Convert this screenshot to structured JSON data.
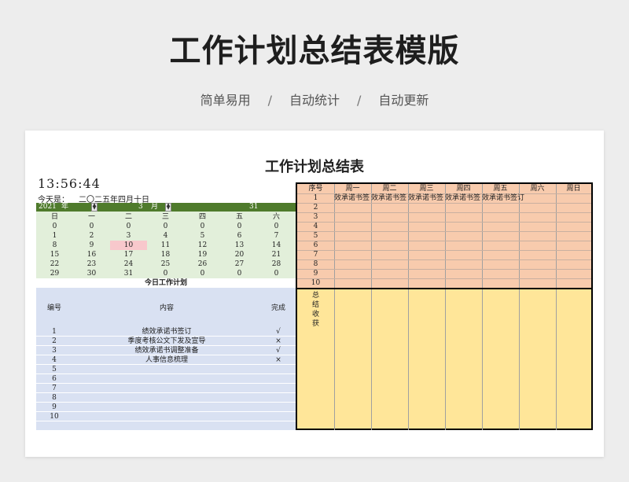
{
  "banner": {
    "title": "工作计划总结表模版",
    "tags": [
      "简单易用",
      "自动统计",
      "自动更新"
    ],
    "separator": "/"
  },
  "sheet": {
    "title": "工作计划总结表",
    "clock": "13:56:44",
    "today_label": "今天是：",
    "today_value": "二〇二五年四月十日",
    "calendar": {
      "year": "2021",
      "year_suffix": "年",
      "month": "3",
      "month_suffix": "月",
      "day": "31",
      "weekdays": [
        "日",
        "一",
        "二",
        "三",
        "四",
        "五",
        "六"
      ],
      "weeks": [
        [
          "0",
          "0",
          "0",
          "0",
          "0",
          "0",
          "0"
        ],
        [
          "1",
          "2",
          "3",
          "4",
          "5",
          "6",
          "7"
        ],
        [
          "8",
          "9",
          "10",
          "11",
          "12",
          "13",
          "14"
        ],
        [
          "15",
          "16",
          "17",
          "18",
          "19",
          "20",
          "21"
        ],
        [
          "22",
          "23",
          "24",
          "25",
          "26",
          "27",
          "28"
        ],
        [
          "29",
          "30",
          "31",
          "0",
          "0",
          "0",
          "0"
        ]
      ],
      "highlight_color": "#f8c8cc"
    },
    "today_plan": {
      "title": "今日工作计划",
      "headers": {
        "no": "编号",
        "content": "内容",
        "done": "完成"
      },
      "rows": [
        {
          "no": "1",
          "content": "绩效承诺书签订",
          "done": "√"
        },
        {
          "no": "2",
          "content": "季度考核公文下发及宣导",
          "done": "×"
        },
        {
          "no": "3",
          "content": "绩效承诺书调整准备",
          "done": "√"
        },
        {
          "no": "4",
          "content": "人事信息梳理",
          "done": "×"
        },
        {
          "no": "5",
          "content": "",
          "done": ""
        },
        {
          "no": "6",
          "content": "",
          "done": ""
        },
        {
          "no": "7",
          "content": "",
          "done": ""
        },
        {
          "no": "8",
          "content": "",
          "done": ""
        },
        {
          "no": "9",
          "content": "",
          "done": ""
        },
        {
          "no": "10",
          "content": "",
          "done": ""
        }
      ]
    },
    "week_plan": {
      "headers": [
        "序号",
        "周一",
        "周二",
        "周三",
        "周四",
        "周五",
        "周六",
        "周日"
      ],
      "row_numbers": [
        "1",
        "2",
        "3",
        "4",
        "5",
        "6",
        "7",
        "8",
        "9",
        "10"
      ],
      "row1_tasks": [
        "效承诺书签",
        "效承诺书签",
        "效承诺书签",
        "效承诺书签",
        "效承诺书签订"
      ],
      "summary_label": [
        "总",
        "结",
        "收",
        "获"
      ]
    },
    "colors": {
      "calendar_header": "#4f7b2c",
      "calendar_body": "#e2efda",
      "plan_body": "#d9e1f2",
      "week_top": "#f8cbad",
      "week_bottom": "#ffe699"
    }
  }
}
